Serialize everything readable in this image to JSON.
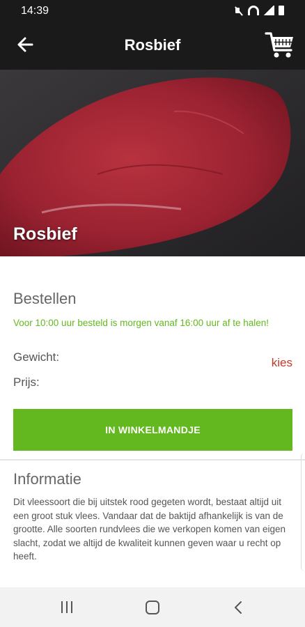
{
  "status_bar": {
    "time": "14:39",
    "icons": [
      "mute-icon",
      "wifi-icon",
      "signal-icon",
      "battery-icon"
    ]
  },
  "app_bar": {
    "title": "Rosbief",
    "back_icon": "arrow-left-icon",
    "cart_icon": "shopping-cart-icon"
  },
  "hero": {
    "title": "Rosbief"
  },
  "order": {
    "heading": "Bestellen",
    "note": "Voor 10:00 uur besteld is morgen vanaf 16:00 uur af te halen!",
    "weight_label": "Gewicht:",
    "choose_label": "kies",
    "price_label": "Prijs:",
    "add_to_cart_label": "IN WINKELMANDJE"
  },
  "info": {
    "heading": "Informatie",
    "text": "Dit vleessoort die bij uitstek rood gegeten wordt, bestaat altijd uit een groot stuk vlees. Vandaar dat de baktijd afhankelijk is van de grootte. Alle soorten rundvlees die we verkopen komen van eigen slacht, zodat we altijd de kwaliteit kunnen geven waar u recht op heeft."
  },
  "navigation": {
    "icons": [
      "recent-apps-icon",
      "home-icon",
      "back-icon"
    ]
  },
  "colors": {
    "app_bar": "#1a1a1a",
    "accent_green": "#63b81f",
    "link_red": "#c0392b",
    "heading_gray": "#666666"
  }
}
